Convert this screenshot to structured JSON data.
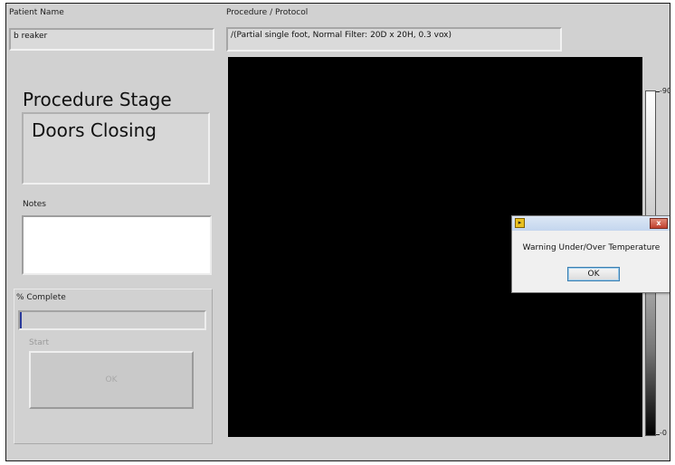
{
  "patient": {
    "label": "Patient Name",
    "value": "b reaker"
  },
  "procedure": {
    "label": "Procedure / Protocol",
    "value": "/(Partial single foot, Normal Filter:  20D x 20H, 0.3 vox)"
  },
  "stage": {
    "title": "Procedure Stage",
    "value": "Doors Closing"
  },
  "notes": {
    "label": "Notes",
    "value": ""
  },
  "progress": {
    "label": "% Complete",
    "percent": 1
  },
  "start": {
    "label": "Start",
    "button_label": "OK"
  },
  "scale": {
    "max_tick": "-90",
    "min_tick": "-0"
  },
  "dialog": {
    "icon": "labview-icon",
    "message": "Warning Under/Over Temperature",
    "ok_label": "OK",
    "close_label": "x"
  }
}
